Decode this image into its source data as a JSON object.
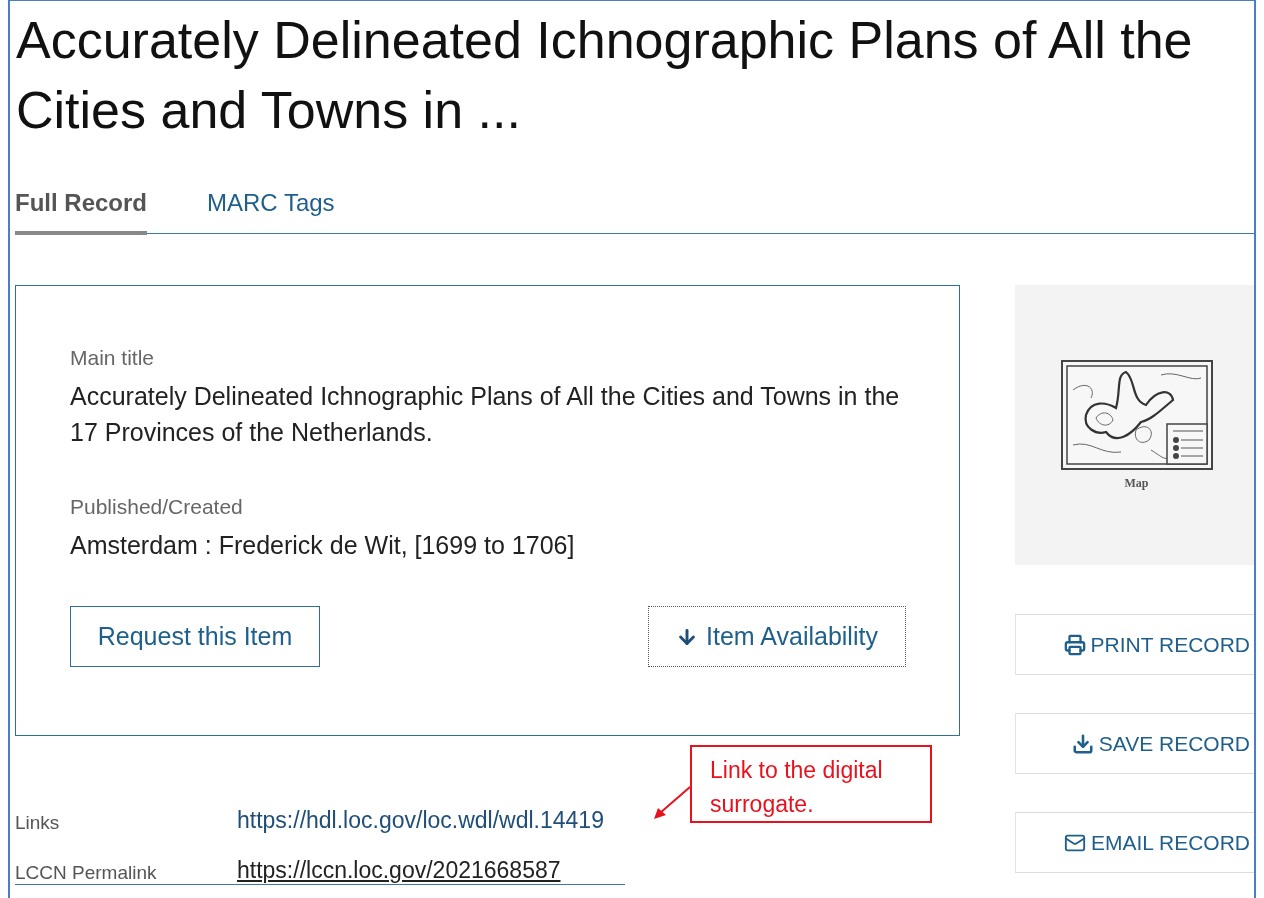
{
  "page_title": "Accurately Delineated Ichnographic Plans of All the Cities and Towns in ...",
  "tabs": [
    {
      "label": "Full Record",
      "selected": true
    },
    {
      "label": "MARC Tags",
      "selected": false
    }
  ],
  "record_card": {
    "fields": [
      {
        "label": "Main title",
        "value": "Accurately Delineated Ichnographic Plans of All the Cities and Towns in the 17 Provinces of the Netherlands."
      },
      {
        "label": "Published/Created",
        "value": "Amsterdam : Frederick de Wit, [1699 to 1706]"
      }
    ],
    "buttons": [
      {
        "label": "Request this Item",
        "kind": "request"
      },
      {
        "label": "Item Availability",
        "kind": "availability"
      }
    ]
  },
  "thumbnail": {
    "caption": "Map"
  },
  "actions": [
    {
      "label": "PRINT RECORD",
      "kind": "print"
    },
    {
      "label": "SAVE RECORD",
      "kind": "save"
    },
    {
      "label": "EMAIL RECORD",
      "kind": "email"
    }
  ],
  "links": [
    {
      "label": "Links",
      "url": "https://hdl.loc.gov/loc.wdl/wdl.14419",
      "underlined": false
    },
    {
      "label": "LCCN Permalink",
      "url": "https://lccn.loc.gov/2021668587",
      "underlined": true
    }
  ],
  "annotation": {
    "text": "Link to the digital surrogate."
  }
}
